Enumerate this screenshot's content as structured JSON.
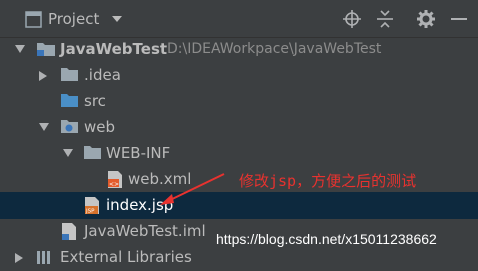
{
  "header": {
    "title": "Project"
  },
  "tree": {
    "root": {
      "name": "JavaWebTest",
      "path": "D:\\IDEAWorkpace\\JavaWebTest"
    },
    "idea": "idea",
    "src": "src",
    "web": "web",
    "webinf": "WEB-INF",
    "webxml": "web.xml",
    "indexjsp": "index.jsp",
    "iml": "JavaWebTest.iml",
    "external": "External Libraries"
  },
  "annotation": "修改jsp，方便之后的测试",
  "watermark": "https://blog.csdn.net/x15011238662",
  "colors": {
    "background": "#3c3f41",
    "selection": "#0d293e",
    "annotation": "#e8322f"
  }
}
